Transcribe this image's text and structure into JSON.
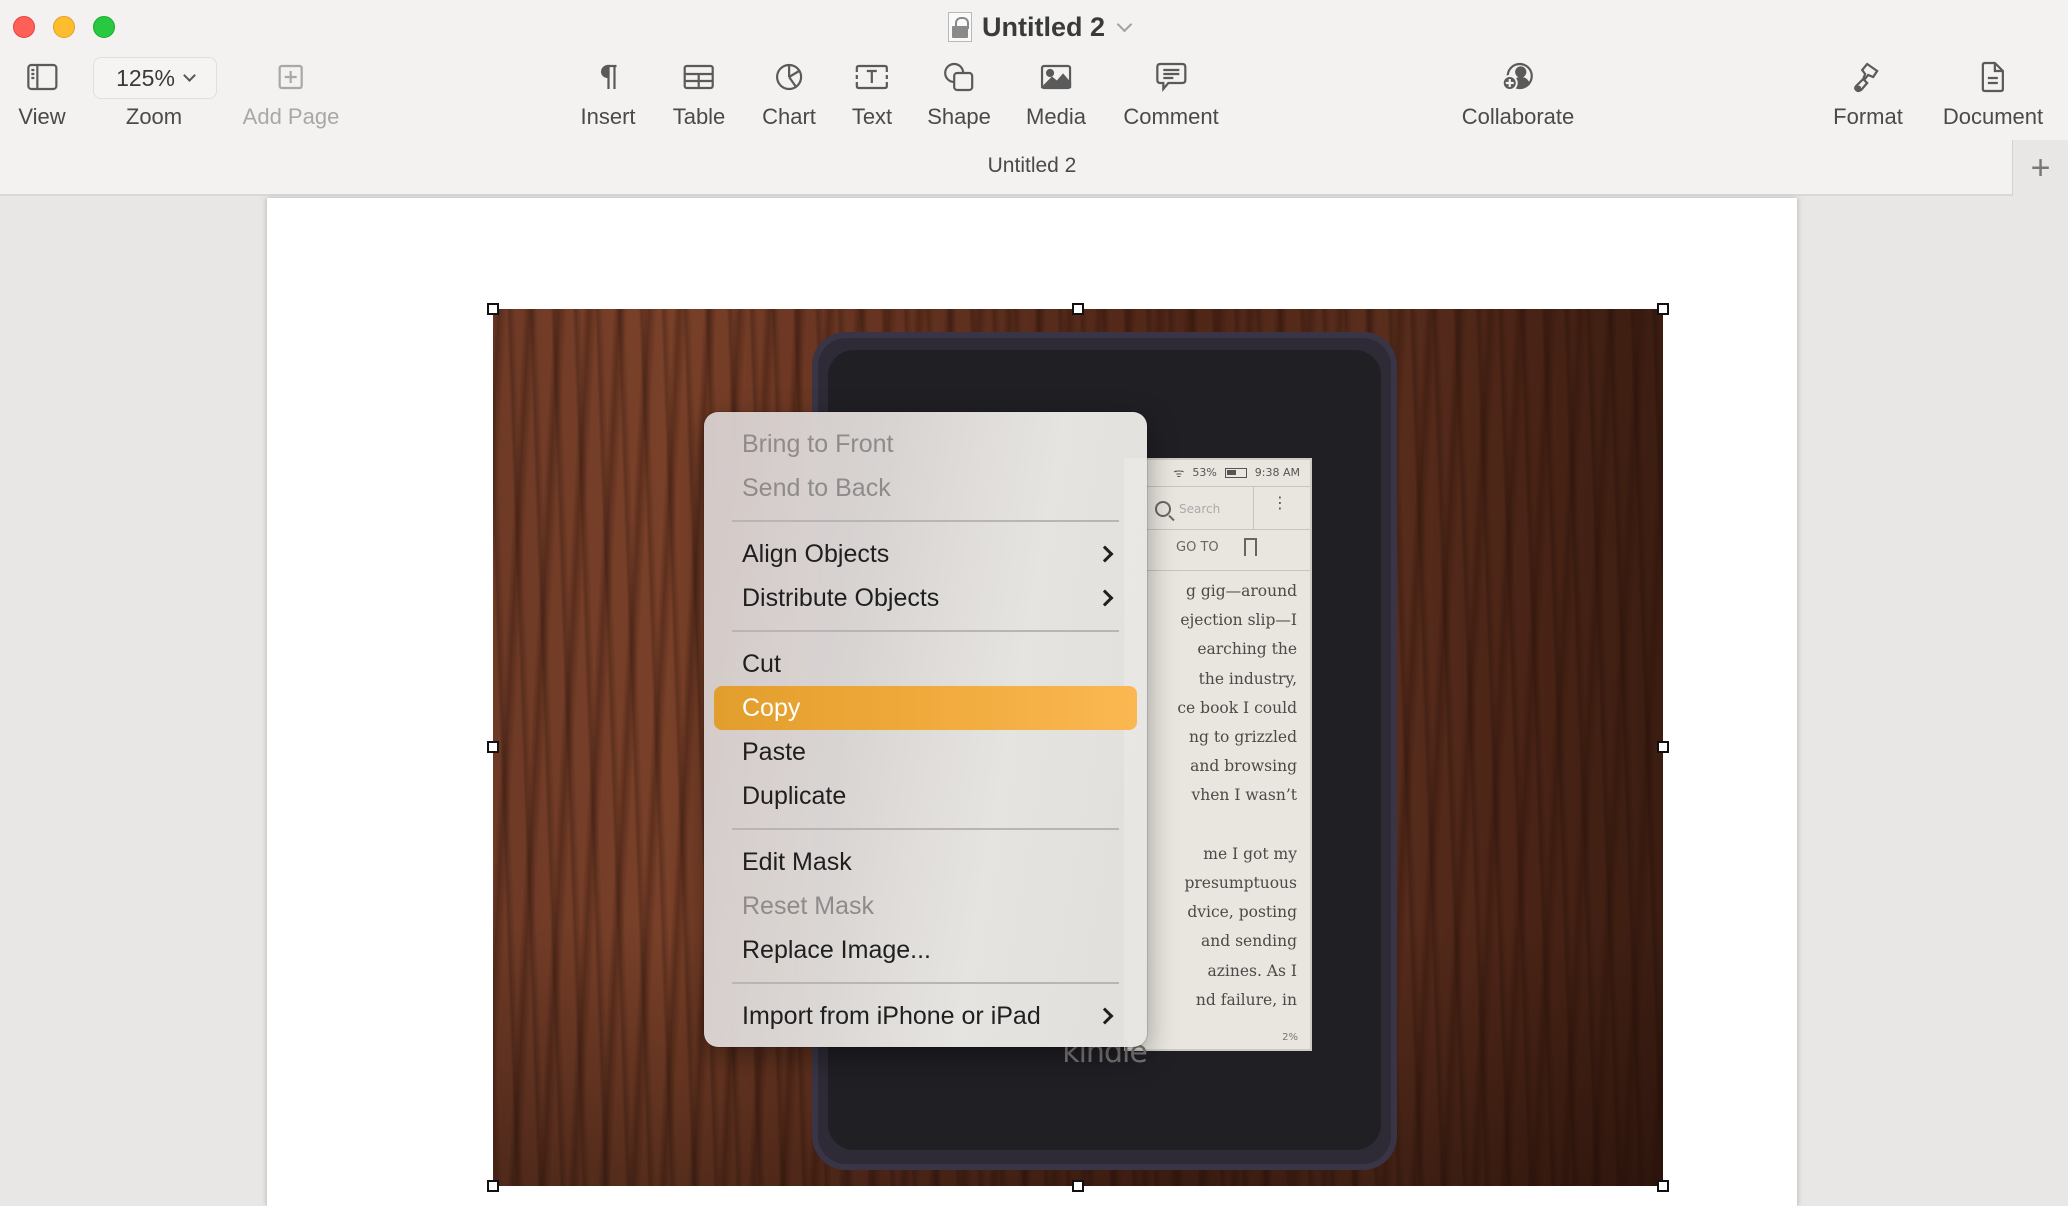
{
  "window": {
    "title": "Untitled 2",
    "controls": {
      "close": "close",
      "minimize": "minimize",
      "maximize": "maximize"
    }
  },
  "toolbar": {
    "view_label": "View",
    "zoom_value": "125%",
    "zoom_label": "Zoom",
    "add_page_label": "Add Page",
    "insert_label": "Insert",
    "table_label": "Table",
    "chart_label": "Chart",
    "text_label": "Text",
    "shape_label": "Shape",
    "media_label": "Media",
    "comment_label": "Comment",
    "collaborate_label": "Collaborate",
    "format_label": "Format",
    "document_label": "Document"
  },
  "tabbar": {
    "document_tab": "Untitled 2",
    "add_tab_symbol": "+"
  },
  "photo": {
    "kindle": {
      "wifi": "ᯤ",
      "battery": "53%",
      "time": "9:38 AM",
      "search_placeholder": "Search",
      "more": "⋮",
      "goto": "GO TO",
      "progress": "2%",
      "logo": "kindle",
      "lines": [
        "g gig—around",
        "ejection slip—I",
        "earching  the",
        "the  industry,",
        "ce book I could",
        "ng  to  grizzled",
        "and  browsing",
        "vhen  I  wasn’t",
        "",
        "me  I  got  my",
        "presumptuous",
        "dvice,  posting",
        "and  sending",
        "azines.   As   I",
        "nd  failure,  in"
      ]
    }
  },
  "context_menu": {
    "items": [
      {
        "label": "Bring to Front",
        "disabled": true
      },
      {
        "label": "Send to Back",
        "disabled": true
      },
      {
        "label": "Align Objects",
        "submenu": true
      },
      {
        "label": "Distribute Objects",
        "submenu": true
      },
      {
        "label": "Cut"
      },
      {
        "label": "Copy",
        "highlighted": true
      },
      {
        "label": "Paste"
      },
      {
        "label": "Duplicate"
      },
      {
        "label": "Edit Mask"
      },
      {
        "label": "Reset Mask",
        "disabled": true
      },
      {
        "label": "Replace Image..."
      },
      {
        "label": "Import from iPhone or iPad",
        "submenu": true
      }
    ]
  },
  "colors": {
    "highlight": "#f0aa3c",
    "close": "#fe5f57",
    "minimize": "#febc2e",
    "maximize": "#28c840"
  }
}
